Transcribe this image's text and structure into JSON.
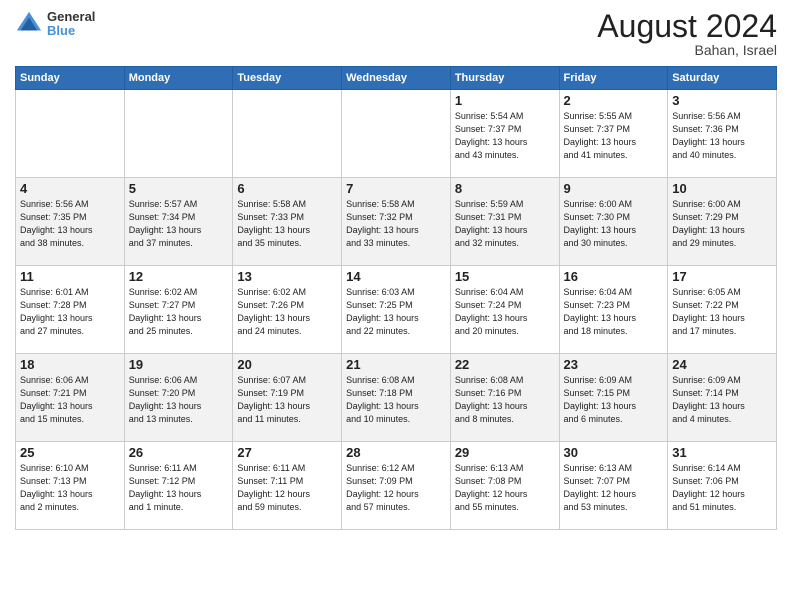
{
  "header": {
    "logo_line1": "General",
    "logo_line2": "Blue",
    "month_title": "August 2024",
    "location": "Bahan, Israel"
  },
  "days_of_week": [
    "Sunday",
    "Monday",
    "Tuesday",
    "Wednesday",
    "Thursday",
    "Friday",
    "Saturday"
  ],
  "weeks": [
    [
      {
        "day": "",
        "info": ""
      },
      {
        "day": "",
        "info": ""
      },
      {
        "day": "",
        "info": ""
      },
      {
        "day": "",
        "info": ""
      },
      {
        "day": "1",
        "info": "Sunrise: 5:54 AM\nSunset: 7:37 PM\nDaylight: 13 hours\nand 43 minutes."
      },
      {
        "day": "2",
        "info": "Sunrise: 5:55 AM\nSunset: 7:37 PM\nDaylight: 13 hours\nand 41 minutes."
      },
      {
        "day": "3",
        "info": "Sunrise: 5:56 AM\nSunset: 7:36 PM\nDaylight: 13 hours\nand 40 minutes."
      }
    ],
    [
      {
        "day": "4",
        "info": "Sunrise: 5:56 AM\nSunset: 7:35 PM\nDaylight: 13 hours\nand 38 minutes."
      },
      {
        "day": "5",
        "info": "Sunrise: 5:57 AM\nSunset: 7:34 PM\nDaylight: 13 hours\nand 37 minutes."
      },
      {
        "day": "6",
        "info": "Sunrise: 5:58 AM\nSunset: 7:33 PM\nDaylight: 13 hours\nand 35 minutes."
      },
      {
        "day": "7",
        "info": "Sunrise: 5:58 AM\nSunset: 7:32 PM\nDaylight: 13 hours\nand 33 minutes."
      },
      {
        "day": "8",
        "info": "Sunrise: 5:59 AM\nSunset: 7:31 PM\nDaylight: 13 hours\nand 32 minutes."
      },
      {
        "day": "9",
        "info": "Sunrise: 6:00 AM\nSunset: 7:30 PM\nDaylight: 13 hours\nand 30 minutes."
      },
      {
        "day": "10",
        "info": "Sunrise: 6:00 AM\nSunset: 7:29 PM\nDaylight: 13 hours\nand 29 minutes."
      }
    ],
    [
      {
        "day": "11",
        "info": "Sunrise: 6:01 AM\nSunset: 7:28 PM\nDaylight: 13 hours\nand 27 minutes."
      },
      {
        "day": "12",
        "info": "Sunrise: 6:02 AM\nSunset: 7:27 PM\nDaylight: 13 hours\nand 25 minutes."
      },
      {
        "day": "13",
        "info": "Sunrise: 6:02 AM\nSunset: 7:26 PM\nDaylight: 13 hours\nand 24 minutes."
      },
      {
        "day": "14",
        "info": "Sunrise: 6:03 AM\nSunset: 7:25 PM\nDaylight: 13 hours\nand 22 minutes."
      },
      {
        "day": "15",
        "info": "Sunrise: 6:04 AM\nSunset: 7:24 PM\nDaylight: 13 hours\nand 20 minutes."
      },
      {
        "day": "16",
        "info": "Sunrise: 6:04 AM\nSunset: 7:23 PM\nDaylight: 13 hours\nand 18 minutes."
      },
      {
        "day": "17",
        "info": "Sunrise: 6:05 AM\nSunset: 7:22 PM\nDaylight: 13 hours\nand 17 minutes."
      }
    ],
    [
      {
        "day": "18",
        "info": "Sunrise: 6:06 AM\nSunset: 7:21 PM\nDaylight: 13 hours\nand 15 minutes."
      },
      {
        "day": "19",
        "info": "Sunrise: 6:06 AM\nSunset: 7:20 PM\nDaylight: 13 hours\nand 13 minutes."
      },
      {
        "day": "20",
        "info": "Sunrise: 6:07 AM\nSunset: 7:19 PM\nDaylight: 13 hours\nand 11 minutes."
      },
      {
        "day": "21",
        "info": "Sunrise: 6:08 AM\nSunset: 7:18 PM\nDaylight: 13 hours\nand 10 minutes."
      },
      {
        "day": "22",
        "info": "Sunrise: 6:08 AM\nSunset: 7:16 PM\nDaylight: 13 hours\nand 8 minutes."
      },
      {
        "day": "23",
        "info": "Sunrise: 6:09 AM\nSunset: 7:15 PM\nDaylight: 13 hours\nand 6 minutes."
      },
      {
        "day": "24",
        "info": "Sunrise: 6:09 AM\nSunset: 7:14 PM\nDaylight: 13 hours\nand 4 minutes."
      }
    ],
    [
      {
        "day": "25",
        "info": "Sunrise: 6:10 AM\nSunset: 7:13 PM\nDaylight: 13 hours\nand 2 minutes."
      },
      {
        "day": "26",
        "info": "Sunrise: 6:11 AM\nSunset: 7:12 PM\nDaylight: 13 hours\nand 1 minute."
      },
      {
        "day": "27",
        "info": "Sunrise: 6:11 AM\nSunset: 7:11 PM\nDaylight: 12 hours\nand 59 minutes."
      },
      {
        "day": "28",
        "info": "Sunrise: 6:12 AM\nSunset: 7:09 PM\nDaylight: 12 hours\nand 57 minutes."
      },
      {
        "day": "29",
        "info": "Sunrise: 6:13 AM\nSunset: 7:08 PM\nDaylight: 12 hours\nand 55 minutes."
      },
      {
        "day": "30",
        "info": "Sunrise: 6:13 AM\nSunset: 7:07 PM\nDaylight: 12 hours\nand 53 minutes."
      },
      {
        "day": "31",
        "info": "Sunrise: 6:14 AM\nSunset: 7:06 PM\nDaylight: 12 hours\nand 51 minutes."
      }
    ]
  ]
}
